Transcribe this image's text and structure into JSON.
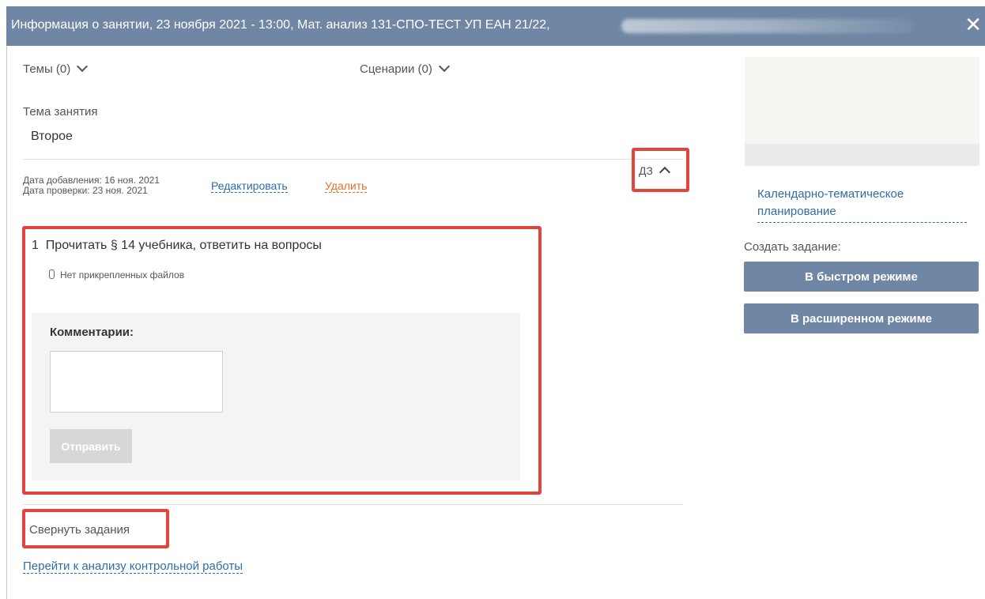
{
  "dialog": {
    "title": "Информация о занятии, 23 ноября 2021 - 13:00, Мат. анализ 131-СПО-ТЕСТ УП ЕАН 21/22,",
    "close_glyph": "✕"
  },
  "tabs": {
    "topics_label": "Темы (0)",
    "scenarios_label": "Сценарии (0)"
  },
  "lesson_topic": {
    "label": "Тема занятия",
    "value": "Второе"
  },
  "homework_meta": {
    "date_added": "Дата добавления: 16 ноя. 2021",
    "date_checked": "Дата проверки: 23 ноя. 2021",
    "edit_label": "Редактировать",
    "delete_label": "Удалить",
    "toggle_label": "ДЗ"
  },
  "assignment": {
    "number": "1",
    "text": "Прочитать § 14 учебника, ответить на вопросы",
    "attachments_text": "Нет прикрепленных файлов"
  },
  "comments": {
    "heading": "Комментарии:",
    "input_value": "",
    "send_label": "Отправить"
  },
  "footer": {
    "collapse_label": "Свернуть задания",
    "analysis_link": "Перейти к анализу контрольной работы"
  },
  "sidebar": {
    "planning_link": "Календарно-тематическое планирование",
    "create_label": "Создать задание:",
    "quick_mode_label": "В быстром режиме",
    "extended_mode_label": "В расширенном режиме"
  },
  "colors": {
    "header": "#6f87a4",
    "highlight": "#e2443e",
    "link": "#2e6ea7",
    "danger_link": "#e1712b"
  }
}
